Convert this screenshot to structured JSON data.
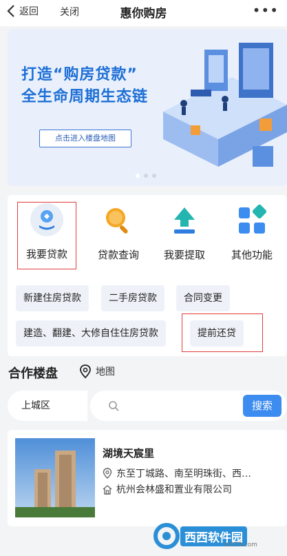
{
  "nav": {
    "back_label": "返回",
    "close_label": "关闭",
    "title": "惠你购房",
    "more": "•••"
  },
  "banner": {
    "line1": "打造“购房贷款”",
    "line2": "全生命周期生态链",
    "cta": "点击进入楼盘地图"
  },
  "features": [
    {
      "label": "我要贷款",
      "icon": "loan-icon",
      "highlighted": true
    },
    {
      "label": "贷款查询",
      "icon": "magnifier-icon"
    },
    {
      "label": "我要提取",
      "icon": "upload-icon"
    },
    {
      "label": "其他功能",
      "icon": "grid-icon"
    }
  ],
  "loan_types": {
    "new_house": "新建住房贷款",
    "second_hand": "二手房贷款",
    "contract_change": "合同变更",
    "build_renovate": "建造、翻建、大修自住住房贷款",
    "prepay": "提前还贷"
  },
  "section": {
    "title": "合作楼盘",
    "map_label": "地图"
  },
  "search": {
    "district": "上城区",
    "placeholder": "",
    "button": "搜索"
  },
  "listing": {
    "name": "湖境天宸里",
    "address": "东至丁城路、南至明珠街、西…",
    "developer": "杭州会林盛和置业有限公司"
  },
  "watermark": {
    "text": "西西软件园",
    "url": "cr173.com"
  },
  "colors": {
    "accent": "#3d8cf0",
    "highlight": "#e13a3a",
    "brand_blue": "#1d6fd6"
  }
}
